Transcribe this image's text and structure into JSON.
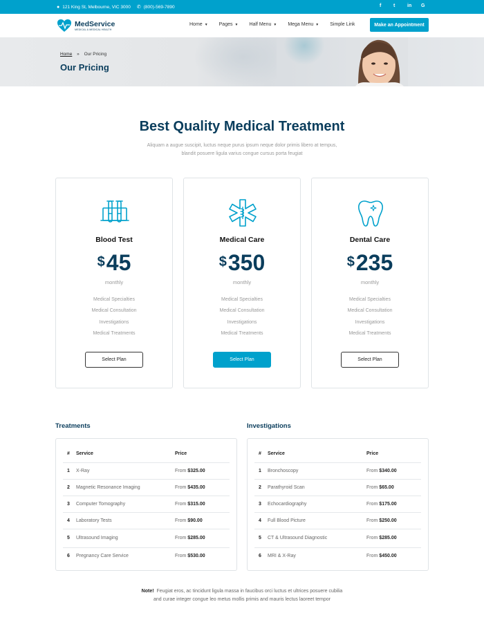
{
  "topbar": {
    "address": "121 King St, Melbourne, VIC 3000",
    "phone": "(800)-569-7890",
    "social": [
      "f",
      "t",
      "in",
      "G"
    ]
  },
  "header": {
    "brand": "MedService",
    "tagline": "MEDICAL & MEDICAL HEALTH",
    "nav": [
      {
        "label": "Home",
        "dropdown": true
      },
      {
        "label": "Pages",
        "dropdown": true
      },
      {
        "label": "Half Menu",
        "dropdown": true
      },
      {
        "label": "Mega Menu",
        "dropdown": true
      },
      {
        "label": "Simple Link",
        "dropdown": false
      }
    ],
    "cta": "Make an Appointment"
  },
  "hero": {
    "breadcrumb_home": "Home",
    "breadcrumb_sep": "»",
    "breadcrumb_current": "Our Pricing",
    "title": "Our Pricing"
  },
  "pricing": {
    "title": "Best Quality Medical Treatment",
    "subtitle": "Aliquam a augue suscipit, luctus neque purus ipsum neque dolor primis libero at tempus, blandit posuere ligula varius congue cursus porta feugiat",
    "plans": [
      {
        "name": "Blood Test",
        "currency": "$",
        "amount": "45",
        "period": "monthly",
        "icon": "test-tubes-icon",
        "features": [
          "Medical Specialties",
          "Medical Consultation",
          "Investigations",
          "Medical Treatments"
        ],
        "button": "Select Plan"
      },
      {
        "name": "Medical Care",
        "currency": "$",
        "amount": "350",
        "period": "monthly",
        "icon": "medical-star-icon",
        "features": [
          "Medical Specialties",
          "Medical Consultation",
          "Investigations",
          "Medical Treatments"
        ],
        "button": "Select Plan"
      },
      {
        "name": "Dental Care",
        "currency": "$",
        "amount": "235",
        "period": "monthly",
        "icon": "tooth-icon",
        "features": [
          "Medical Specialties",
          "Medical Consultation",
          "Investigations",
          "Medical Treatments"
        ],
        "button": "Select Plan"
      }
    ]
  },
  "treatments": {
    "title": "Treatments",
    "headers": [
      "#",
      "Service",
      "Price"
    ],
    "rows": [
      {
        "n": "1",
        "service": "X-Ray",
        "from": "From",
        "price": "$325.00"
      },
      {
        "n": "2",
        "service": "Magnetic Resonance Imaging",
        "from": "From",
        "price": "$435.00"
      },
      {
        "n": "3",
        "service": "Computer Tomography",
        "from": "From",
        "price": "$315.00"
      },
      {
        "n": "4",
        "service": "Laboratory Tests",
        "from": "From",
        "price": "$90.00"
      },
      {
        "n": "5",
        "service": "Ultrasound Imaging",
        "from": "From",
        "price": "$285.00"
      },
      {
        "n": "6",
        "service": "Pregnancy Care Service",
        "from": "From",
        "price": "$530.00"
      }
    ]
  },
  "investigations": {
    "title": "Investigations",
    "headers": [
      "#",
      "Service",
      "Price"
    ],
    "rows": [
      {
        "n": "1",
        "service": "Bronchoscopy",
        "from": "From",
        "price": "$340.00"
      },
      {
        "n": "2",
        "service": "Parathyroid Scan",
        "from": "From",
        "price": "$65.00"
      },
      {
        "n": "3",
        "service": "Echocardiography",
        "from": "From",
        "price": "$175.00"
      },
      {
        "n": "4",
        "service": "Full Blood Picture",
        "from": "From",
        "price": "$250.00"
      },
      {
        "n": "5",
        "service": "CT & Ultrasound Diagnostic",
        "from": "From",
        "price": "$285.00"
      },
      {
        "n": "6",
        "service": "MRI & X-Ray",
        "from": "From",
        "price": "$450.00"
      }
    ]
  },
  "note": {
    "label": "Note!",
    "line1": "Feugiat eros, ac tincidunt ligula massa in faucibus orci luctus et ultrices posuere cubilia",
    "line2": "and curae integer congue leo metus mollis primis and mauris lectus laoreet tempor"
  },
  "colors": {
    "accent": "#00a1cc",
    "navy": "#0a3d5c"
  }
}
